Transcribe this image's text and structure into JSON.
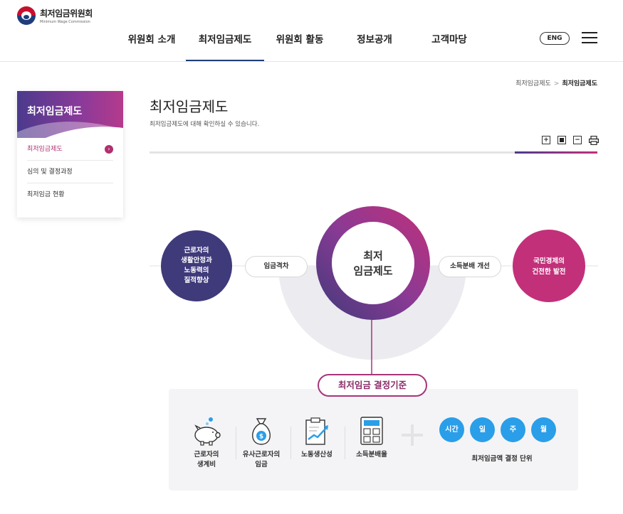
{
  "header": {
    "logo_name": "최저임금위원회",
    "logo_sub": "Minimum Wage Commission",
    "nav": [
      "위원회 소개",
      "최저임금제도",
      "위원회 활동",
      "정보공개",
      "고객마당"
    ],
    "active_nav_index": 1,
    "eng_label": "ENG",
    "menu_icon": "hamburger-icon"
  },
  "sidebar": {
    "title": "최저임금제도",
    "items": [
      {
        "label": "최저임금제도",
        "active": true
      },
      {
        "label": "심의 및 결정과정",
        "active": false
      },
      {
        "label": "최저임금 현황",
        "active": false
      }
    ]
  },
  "breadcrumb": {
    "parent": "최저임금제도",
    "separator": ">",
    "current": "최저임금제도"
  },
  "page": {
    "title": "최저임금제도",
    "description": "최저임금제도에 대해 확인하실 수 있습니다.",
    "tools": [
      "zoom-in-icon",
      "reset-zoom-icon",
      "zoom-out-icon",
      "print-icon"
    ],
    "tool_symbols": {
      "zoom_in": "+",
      "zoom_out": "−"
    }
  },
  "diagram": {
    "center": {
      "line1": "최저",
      "line2": "임금제도"
    },
    "left_circle": {
      "line1": "근로자의",
      "line2": "생활안정과",
      "line3": "노동력의",
      "line4": "질적향상"
    },
    "right_circle": {
      "line1": "국민경제의",
      "line2": "건전한 발전"
    },
    "left_pill": "임금격차",
    "right_pill": "소득분배 개선",
    "criteria_title": "최저임금 결정기준",
    "criteria": [
      {
        "label_line1": "근로자의",
        "label_line2": "생계비",
        "icon": "piggy-bank-icon"
      },
      {
        "label_line1": "유사근로자의",
        "label_line2": "임금",
        "icon": "money-bag-icon"
      },
      {
        "label_line1": "노동생산성",
        "label_line2": "",
        "icon": "productivity-chart-icon"
      },
      {
        "label_line1": "소득분배율",
        "label_line2": "",
        "icon": "calculator-icon"
      }
    ],
    "units": [
      "시간",
      "일",
      "주",
      "월"
    ],
    "units_label": "최저임금액 결정 단위",
    "colors": {
      "navy": "#3f3a7a",
      "magenta": "#c2307a",
      "unit_blue": "#2a9ee8",
      "arc_gray": "#e9e9ef"
    }
  }
}
